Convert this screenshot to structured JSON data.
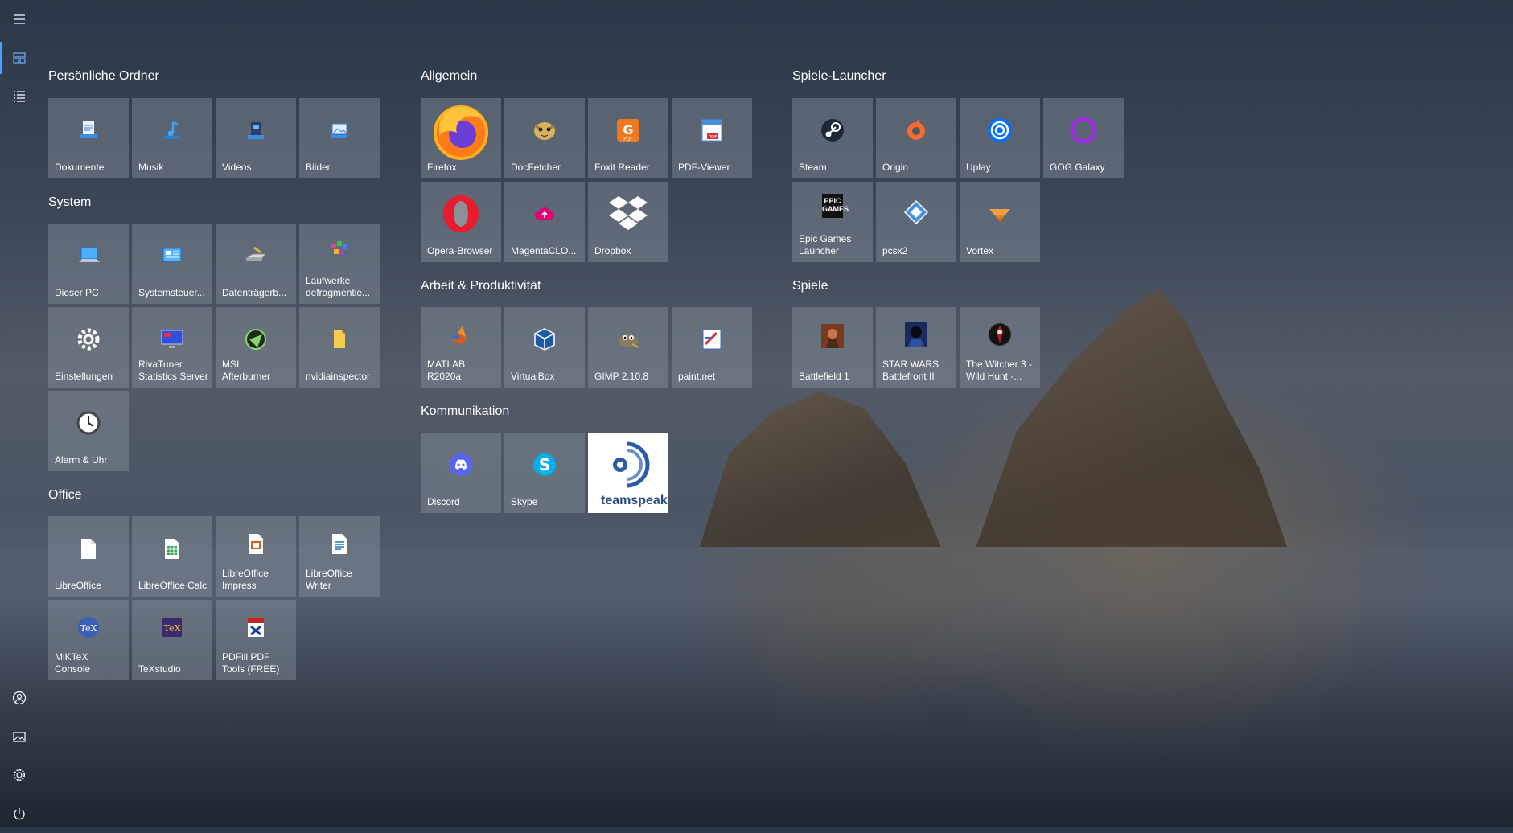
{
  "groups": {
    "personal": "Persönliche Ordner",
    "system": "System",
    "office": "Office",
    "general": "Allgemein",
    "work": "Arbeit & Produktivität",
    "comm": "Kommunikation",
    "launchers": "Spiele-Launcher",
    "games": "Spiele"
  },
  "tiles": {
    "dokumente": "Dokumente",
    "musik": "Musik",
    "videos": "Videos",
    "bilder": "Bilder",
    "dieser_pc": "Dieser PC",
    "systemsteuerung": "Systemsteuer...",
    "datentraeger": "Datenträgerb...",
    "laufwerke": "Laufwerke\ndefragmentie...",
    "einstellungen": "Einstellungen",
    "rivatuner": "RivaTuner\nStatistics Server",
    "msi": "MSI\nAfterburner",
    "nvidiainspector": "nvidiainspector",
    "alarm": "Alarm & Uhr",
    "libreoffice": "LibreOffice",
    "calc": "LibreOffice Calc",
    "impress": "LibreOffice\nImpress",
    "writer": "LibreOffice\nWriter",
    "miktex": "MiKTeX\nConsole",
    "texstudio": "TeXstudio",
    "pdfill": "PDFill PDF\nTools (FREE)",
    "firefox": "Firefox",
    "docfetcher": "DocFetcher",
    "foxit": "Foxit Reader",
    "pdfviewer": "PDF-Viewer",
    "opera": "Opera-Browser",
    "magenta": "MagentaCLO...",
    "dropbox": "Dropbox",
    "matlab": "MATLAB\nR2020a",
    "virtualbox": "VirtualBox",
    "gimp": "GIMP 2.10.8",
    "paintnet": "paint.net",
    "discord": "Discord",
    "skype": "Skype",
    "teamspeak_logo": "teamspeak",
    "steam": "Steam",
    "origin": "Origin",
    "uplay": "Uplay",
    "gog": "GOG Galaxy",
    "epic": "Epic Games\nLauncher",
    "epic_logo": "EPIC\nGAMES",
    "pcsx2": "pcsx2",
    "vortex": "Vortex",
    "bf1": "Battlefield 1",
    "swbf": "STAR WARS\nBattlefront II",
    "witcher": "The Witcher 3 -\nWild Hunt -..."
  }
}
